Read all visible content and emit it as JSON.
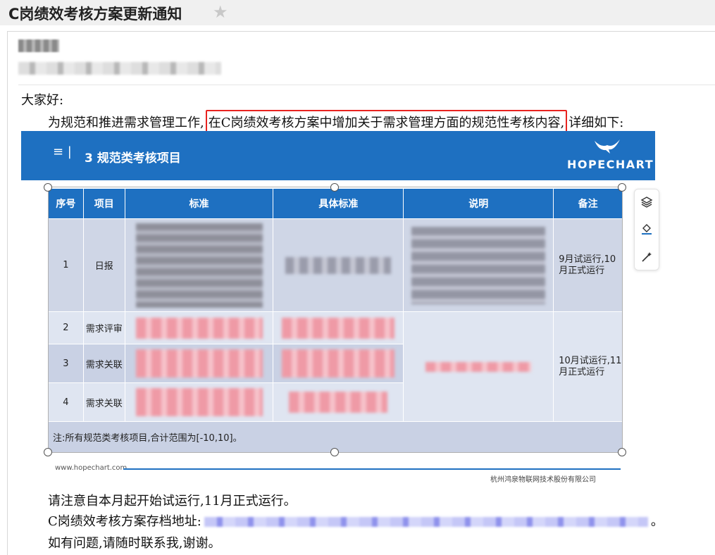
{
  "email": {
    "subject": "C岗绩效考核方案更新通知",
    "greeting": "大家好:",
    "intro_before": "为规范和推进需求管理工作,",
    "intro_highlight": "在C岗绩效考核方案中增加关于需求管理方面的规范性考核内容,",
    "intro_after": "详细如下:",
    "note": "请注意自本月起开始试运行,11月正式运行。",
    "link_label": "C岗绩效考核方案存档地址:",
    "link_end": "。",
    "contact": "如有问题,请随时联系我,谢谢。"
  },
  "slide": {
    "section_title": "3 规范类考核项目",
    "brand": "HOPECHART",
    "headers": [
      "序号",
      "项目",
      "标准",
      "具体标准",
      "说明",
      "备注"
    ],
    "rows": [
      {
        "no": "1",
        "item": "日报",
        "remark": "9月试运行,10月正式运行"
      },
      {
        "no": "2",
        "item": "需求评审"
      },
      {
        "no": "3",
        "item": "需求关联"
      },
      {
        "no": "4",
        "item": "需求关联"
      }
    ],
    "merged_remark": "10月试运行,11月正式运行",
    "footnote": "注:所有规范类考核项目,合计范围为[-10,10]。",
    "footer_url": "www.hopechart.com",
    "footer_company": "杭州鸿泉物联网技术股份有限公司"
  },
  "icons": {
    "star": "star-icon",
    "layers": "layers-icon",
    "paint": "paint-bucket-icon",
    "magic": "magic-wand-icon"
  },
  "colors": {
    "brand_blue": "#1e70c1",
    "highlight_red": "#e8231f"
  }
}
